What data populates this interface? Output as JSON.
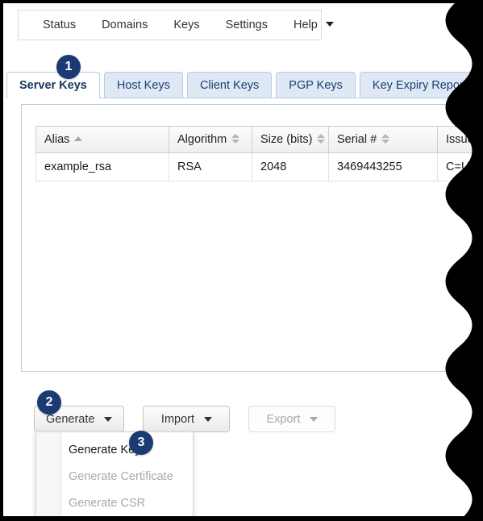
{
  "menubar": {
    "items": [
      {
        "label": "Status",
        "name": "menu-item-status",
        "caret": false
      },
      {
        "label": "Domains",
        "name": "menu-item-domains",
        "caret": false
      },
      {
        "label": "Keys",
        "name": "menu-item-keys",
        "caret": false
      },
      {
        "label": "Settings",
        "name": "menu-item-settings",
        "caret": false
      },
      {
        "label": "Help",
        "name": "menu-item-help",
        "caret": true
      }
    ]
  },
  "tabs": [
    {
      "label": "Server Keys",
      "active": true
    },
    {
      "label": "Host Keys",
      "active": false
    },
    {
      "label": "Client Keys",
      "active": false
    },
    {
      "label": "PGP Keys",
      "active": false
    },
    {
      "label": "Key Expiry Report",
      "active": false
    }
  ],
  "table": {
    "columns": [
      {
        "label": "Alias",
        "sort": "asc"
      },
      {
        "label": "Algorithm",
        "sort": "both"
      },
      {
        "label": "Size (bits)",
        "sort": "both"
      },
      {
        "label": "Serial #",
        "sort": "both"
      },
      {
        "label": "Issuer",
        "sort": "both"
      }
    ],
    "rows": [
      {
        "alias": "example_rsa",
        "algorithm": "RSA",
        "size": "2048",
        "serial": "3469443255",
        "issuer": "C=USA"
      }
    ]
  },
  "buttons": [
    {
      "label": "Generate",
      "disabled": false,
      "caret": true
    },
    {
      "label": "Import",
      "disabled": false,
      "caret": true
    },
    {
      "label": "Export",
      "disabled": true,
      "caret": true
    }
  ],
  "dropdown": {
    "items": [
      {
        "label": "Generate Key",
        "disabled": false
      },
      {
        "label": "Generate Certificate",
        "disabled": true
      },
      {
        "label": "Generate CSR",
        "disabled": true
      }
    ]
  },
  "badges": [
    {
      "id": "badge-1",
      "number": "1"
    },
    {
      "id": "badge-2",
      "number": "2"
    },
    {
      "id": "badge-3",
      "number": "3"
    }
  ],
  "colors": {
    "badge": "#1a3a73",
    "tab_active_text": "#16335e",
    "tab_inactive_bg": "#dfe9f6",
    "tab_border": "#b9cbe3",
    "torn_edge": "#000000"
  }
}
